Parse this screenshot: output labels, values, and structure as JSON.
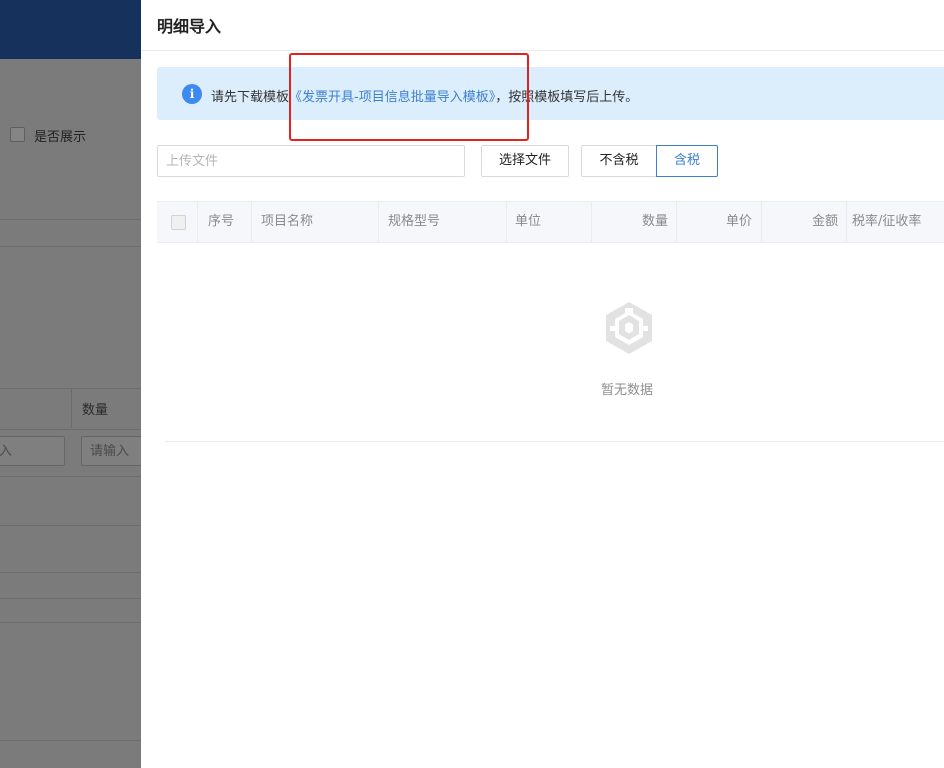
{
  "background": {
    "checkbox_label": "是否展示",
    "table_header": "数量",
    "input_partial": "入",
    "input_placeholder": "请输入"
  },
  "drawer": {
    "title": "明细导入",
    "alert": {
      "prefix": "请先下载模板",
      "link": "《发票开具-项目信息批量导入模板》",
      "suffix": "，按照模板填写后上传。",
      "icon": "info-icon"
    },
    "upload": {
      "placeholder": "上传文件",
      "choose_button": "选择文件"
    },
    "tax_toggle": {
      "options": [
        "不含税",
        "含税"
      ],
      "selected": "含税"
    },
    "table": {
      "columns": [
        "序号",
        "项目名称",
        "规格型号",
        "单位",
        "数量",
        "单价",
        "金额",
        "税率/征收率"
      ],
      "rows": [],
      "empty_text": "暂无数据",
      "empty_icon": "empty-box-icon"
    }
  },
  "colors": {
    "header_bg": "#15315c",
    "accent": "#3d7fcf",
    "alert_bg": "#dceefc",
    "highlight": "#e0231f"
  }
}
